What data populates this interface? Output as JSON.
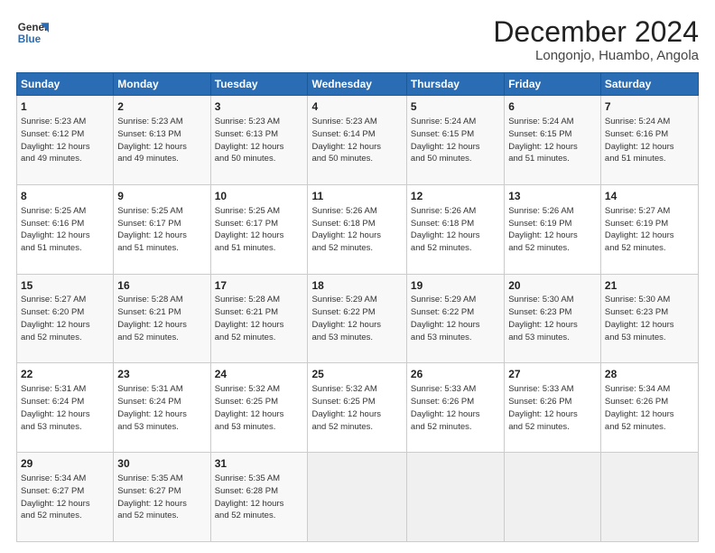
{
  "header": {
    "logo_line1": "General",
    "logo_line2": "Blue",
    "title": "December 2024",
    "subtitle": "Longonjo, Huambo, Angola"
  },
  "weekdays": [
    "Sunday",
    "Monday",
    "Tuesday",
    "Wednesday",
    "Thursday",
    "Friday",
    "Saturday"
  ],
  "weeks": [
    [
      {
        "day": "1",
        "detail": "Sunrise: 5:23 AM\nSunset: 6:12 PM\nDaylight: 12 hours\nand 49 minutes."
      },
      {
        "day": "2",
        "detail": "Sunrise: 5:23 AM\nSunset: 6:13 PM\nDaylight: 12 hours\nand 49 minutes."
      },
      {
        "day": "3",
        "detail": "Sunrise: 5:23 AM\nSunset: 6:13 PM\nDaylight: 12 hours\nand 50 minutes."
      },
      {
        "day": "4",
        "detail": "Sunrise: 5:23 AM\nSunset: 6:14 PM\nDaylight: 12 hours\nand 50 minutes."
      },
      {
        "day": "5",
        "detail": "Sunrise: 5:24 AM\nSunset: 6:15 PM\nDaylight: 12 hours\nand 50 minutes."
      },
      {
        "day": "6",
        "detail": "Sunrise: 5:24 AM\nSunset: 6:15 PM\nDaylight: 12 hours\nand 51 minutes."
      },
      {
        "day": "7",
        "detail": "Sunrise: 5:24 AM\nSunset: 6:16 PM\nDaylight: 12 hours\nand 51 minutes."
      }
    ],
    [
      {
        "day": "8",
        "detail": "Sunrise: 5:25 AM\nSunset: 6:16 PM\nDaylight: 12 hours\nand 51 minutes."
      },
      {
        "day": "9",
        "detail": "Sunrise: 5:25 AM\nSunset: 6:17 PM\nDaylight: 12 hours\nand 51 minutes."
      },
      {
        "day": "10",
        "detail": "Sunrise: 5:25 AM\nSunset: 6:17 PM\nDaylight: 12 hours\nand 51 minutes."
      },
      {
        "day": "11",
        "detail": "Sunrise: 5:26 AM\nSunset: 6:18 PM\nDaylight: 12 hours\nand 52 minutes."
      },
      {
        "day": "12",
        "detail": "Sunrise: 5:26 AM\nSunset: 6:18 PM\nDaylight: 12 hours\nand 52 minutes."
      },
      {
        "day": "13",
        "detail": "Sunrise: 5:26 AM\nSunset: 6:19 PM\nDaylight: 12 hours\nand 52 minutes."
      },
      {
        "day": "14",
        "detail": "Sunrise: 5:27 AM\nSunset: 6:19 PM\nDaylight: 12 hours\nand 52 minutes."
      }
    ],
    [
      {
        "day": "15",
        "detail": "Sunrise: 5:27 AM\nSunset: 6:20 PM\nDaylight: 12 hours\nand 52 minutes."
      },
      {
        "day": "16",
        "detail": "Sunrise: 5:28 AM\nSunset: 6:21 PM\nDaylight: 12 hours\nand 52 minutes."
      },
      {
        "day": "17",
        "detail": "Sunrise: 5:28 AM\nSunset: 6:21 PM\nDaylight: 12 hours\nand 52 minutes."
      },
      {
        "day": "18",
        "detail": "Sunrise: 5:29 AM\nSunset: 6:22 PM\nDaylight: 12 hours\nand 53 minutes."
      },
      {
        "day": "19",
        "detail": "Sunrise: 5:29 AM\nSunset: 6:22 PM\nDaylight: 12 hours\nand 53 minutes."
      },
      {
        "day": "20",
        "detail": "Sunrise: 5:30 AM\nSunset: 6:23 PM\nDaylight: 12 hours\nand 53 minutes."
      },
      {
        "day": "21",
        "detail": "Sunrise: 5:30 AM\nSunset: 6:23 PM\nDaylight: 12 hours\nand 53 minutes."
      }
    ],
    [
      {
        "day": "22",
        "detail": "Sunrise: 5:31 AM\nSunset: 6:24 PM\nDaylight: 12 hours\nand 53 minutes."
      },
      {
        "day": "23",
        "detail": "Sunrise: 5:31 AM\nSunset: 6:24 PM\nDaylight: 12 hours\nand 53 minutes."
      },
      {
        "day": "24",
        "detail": "Sunrise: 5:32 AM\nSunset: 6:25 PM\nDaylight: 12 hours\nand 53 minutes."
      },
      {
        "day": "25",
        "detail": "Sunrise: 5:32 AM\nSunset: 6:25 PM\nDaylight: 12 hours\nand 52 minutes."
      },
      {
        "day": "26",
        "detail": "Sunrise: 5:33 AM\nSunset: 6:26 PM\nDaylight: 12 hours\nand 52 minutes."
      },
      {
        "day": "27",
        "detail": "Sunrise: 5:33 AM\nSunset: 6:26 PM\nDaylight: 12 hours\nand 52 minutes."
      },
      {
        "day": "28",
        "detail": "Sunrise: 5:34 AM\nSunset: 6:26 PM\nDaylight: 12 hours\nand 52 minutes."
      }
    ],
    [
      {
        "day": "29",
        "detail": "Sunrise: 5:34 AM\nSunset: 6:27 PM\nDaylight: 12 hours\nand 52 minutes."
      },
      {
        "day": "30",
        "detail": "Sunrise: 5:35 AM\nSunset: 6:27 PM\nDaylight: 12 hours\nand 52 minutes."
      },
      {
        "day": "31",
        "detail": "Sunrise: 5:35 AM\nSunset: 6:28 PM\nDaylight: 12 hours\nand 52 minutes."
      },
      null,
      null,
      null,
      null
    ]
  ]
}
